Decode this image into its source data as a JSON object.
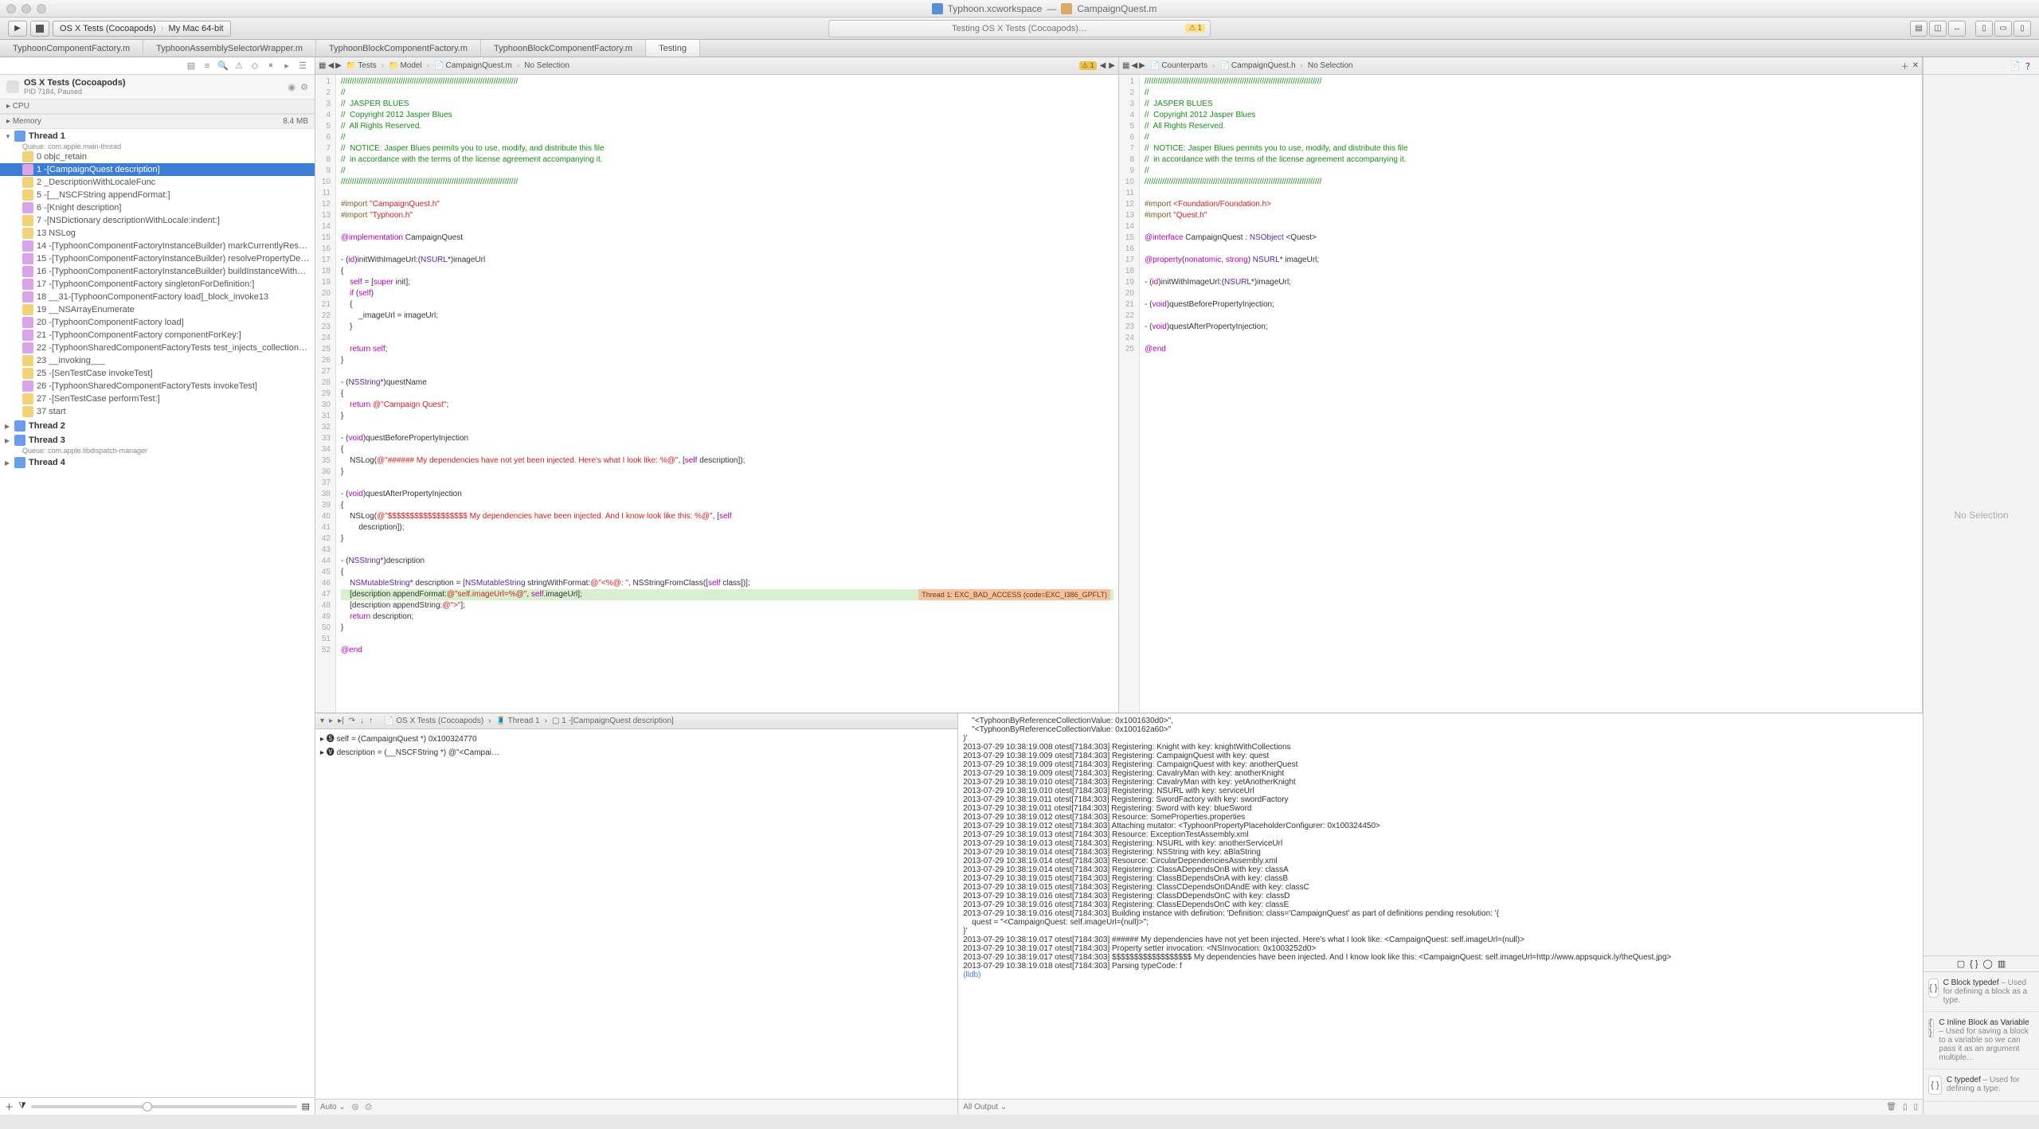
{
  "window": {
    "workspace": "Typhoon.xcworkspace",
    "file": "CampaignQuest.m"
  },
  "toolbar": {
    "scheme": "OS X Tests (Cocoapods)",
    "destination": "My Mac 64-bit",
    "activity": "Testing OS X Tests (Cocoapods)…",
    "warn_count": "1"
  },
  "tabs": [
    "TyphoonComponentFactory.m",
    "TyphoonAssemblySelectorWrapper.m",
    "TyphoonBlockComponentFactory.m",
    "TyphoonBlockComponentFactory.m",
    "Testing"
  ],
  "active_tab": 4,
  "navigator": {
    "title": "OS X Tests (Cocoapods)",
    "subtitle": "PID 7184, Paused",
    "cpu_label": "CPU",
    "memory_label": "Memory",
    "memory_value": "8.4 MB",
    "threads": [
      {
        "name": "Thread 1",
        "queue": "Queue: com.apple.main-thread",
        "expanded": true,
        "frames": [
          {
            "idx": "0",
            "label": "objc_retain",
            "user": false
          },
          {
            "idx": "1",
            "label": "-[CampaignQuest description]",
            "user": true,
            "selected": true
          },
          {
            "idx": "2",
            "label": "_DescriptionWithLocaleFunc",
            "user": false
          },
          {
            "idx": "5",
            "label": "-[__NSCFString appendFormat:]",
            "user": false
          },
          {
            "idx": "6",
            "label": "-[Knight description]",
            "user": true
          },
          {
            "idx": "7",
            "label": "-[NSDictionary descriptionWithLocale:indent:]",
            "user": false
          },
          {
            "idx": "13",
            "label": "NSLog",
            "user": false
          },
          {
            "idx": "14",
            "label": "-[TyphoonComponentFactoryInstanceBuilder) markCurrentlyResolvingDefinition:withInstance:]",
            "user": true
          },
          {
            "idx": "15",
            "label": "-[TyphoonComponentFactoryInstanceBuilder) resolvePropertyDependenciesOn:definition:]",
            "user": true
          },
          {
            "idx": "16",
            "label": "-[TyphoonComponentFactoryInstanceBuilder) buildInstanceWithDefinition:]",
            "user": true
          },
          {
            "idx": "17",
            "label": "-[TyphoonComponentFactory singletonForDefinition:]",
            "user": true
          },
          {
            "idx": "18",
            "label": "__31-[TyphoonComponentFactory load]_block_invoke13",
            "user": true
          },
          {
            "idx": "19",
            "label": "__NSArrayEnumerate",
            "user": false
          },
          {
            "idx": "20",
            "label": "-[TyphoonComponentFactory load]",
            "user": true
          },
          {
            "idx": "21",
            "label": "-[TyphoonComponentFactory componentForKey:]",
            "user": true
          },
          {
            "idx": "22",
            "label": "-[TyphoonSharedComponentFactoryTests test_injects_collection_of_referenced_components_into_set]",
            "user": true
          },
          {
            "idx": "23",
            "label": "__invoking___",
            "user": false
          },
          {
            "idx": "25",
            "label": "-[SenTestCase invokeTest]",
            "user": false
          },
          {
            "idx": "26",
            "label": "-[TyphoonSharedComponentFactoryTests invokeTest]",
            "user": true
          },
          {
            "idx": "27",
            "label": "-[SenTestCase performTest:]",
            "user": false
          },
          {
            "idx": "37",
            "label": "start",
            "user": false
          }
        ]
      },
      {
        "name": "Thread 2"
      },
      {
        "name": "Thread 3",
        "queue": "Queue: com.apple.libdispatch-manager"
      },
      {
        "name": "Thread 4"
      }
    ]
  },
  "editor_left": {
    "path": [
      "Tests",
      "Model",
      "CampaignQuest.m",
      "No Selection"
    ],
    "warn_badge": "1",
    "lines": [
      {
        "n": 1,
        "cls": "c-comment",
        "t": "////////////////////////////////////////////////////////////////////////////////"
      },
      {
        "n": 2,
        "cls": "c-comment",
        "t": "//"
      },
      {
        "n": 3,
        "cls": "c-comment",
        "t": "//  JASPER BLUES"
      },
      {
        "n": 4,
        "cls": "c-comment",
        "t": "//  Copyright 2012 Jasper Blues"
      },
      {
        "n": 5,
        "cls": "c-comment",
        "t": "//  All Rights Reserved."
      },
      {
        "n": 6,
        "cls": "c-comment",
        "t": "//"
      },
      {
        "n": 7,
        "cls": "c-comment",
        "t": "//  NOTICE: Jasper Blues permits you to use, modify, and distribute this file"
      },
      {
        "n": 8,
        "cls": "c-comment",
        "t": "//  in accordance with the terms of the license agreement accompanying it."
      },
      {
        "n": 9,
        "cls": "c-comment",
        "t": "//"
      },
      {
        "n": 10,
        "cls": "c-comment",
        "t": "////////////////////////////////////////////////////////////////////////////////"
      },
      {
        "n": 11,
        "t": ""
      },
      {
        "n": 12,
        "html": "<span class='c-macro'>#import</span> <span class='c-string'>\"CampaignQuest.h\"</span>"
      },
      {
        "n": 13,
        "html": "<span class='c-macro'>#import</span> <span class='c-string'>\"Typhoon.h\"</span>"
      },
      {
        "n": 14,
        "t": ""
      },
      {
        "n": 15,
        "html": "<span class='c-keyword'>@implementation</span> CampaignQuest"
      },
      {
        "n": 16,
        "t": ""
      },
      {
        "n": 17,
        "html": "- (<span class='c-keyword'>id</span>)initWithImageUrl:(<span class='c-type'>NSURL</span>*)imageUrl"
      },
      {
        "n": 18,
        "t": "{"
      },
      {
        "n": 19,
        "html": "    <span class='c-keyword'>self</span> = [<span class='c-keyword'>super</span> init];"
      },
      {
        "n": 20,
        "html": "    <span class='c-keyword'>if</span> (<span class='c-keyword'>self</span>)"
      },
      {
        "n": 21,
        "t": "    {"
      },
      {
        "n": 22,
        "html": "        _imageUrl = imageUrl;"
      },
      {
        "n": 23,
        "t": "    }"
      },
      {
        "n": 24,
        "t": ""
      },
      {
        "n": 25,
        "html": "    <span class='c-keyword'>return</span> <span class='c-keyword'>self</span>;"
      },
      {
        "n": 26,
        "t": "}"
      },
      {
        "n": 27,
        "t": ""
      },
      {
        "n": 28,
        "html": "- (<span class='c-type'>NSString</span>*)questName"
      },
      {
        "n": 29,
        "t": "{"
      },
      {
        "n": 30,
        "html": "    <span class='c-keyword'>return</span> <span class='c-string'>@\"Campaign Quest\"</span>;"
      },
      {
        "n": 31,
        "t": "}"
      },
      {
        "n": 32,
        "t": ""
      },
      {
        "n": 33,
        "html": "- (<span class='c-keyword'>void</span>)questBeforePropertyInjection"
      },
      {
        "n": 34,
        "t": "{"
      },
      {
        "n": 35,
        "html": "    NSLog(<span class='c-string'>@\"###### My dependencies have not yet been injected. Here's what I look like: %@\"</span>, [<span class='c-keyword'>self</span> description]);"
      },
      {
        "n": 36,
        "t": "}"
      },
      {
        "n": 37,
        "t": ""
      },
      {
        "n": 38,
        "html": "- (<span class='c-keyword'>void</span>)questAfterPropertyInjection"
      },
      {
        "n": 39,
        "t": "{"
      },
      {
        "n": 40,
        "html": "    NSLog(<span class='c-string'>@\"$$$$$$$$$$$$$$$$$$ My dependencies have been injected. And I know look like this: %@\"</span>, [<span class='c-keyword'>self</span>"
      },
      {
        "n": 41,
        "html": "        description]);"
      },
      {
        "n": 42,
        "t": "}"
      },
      {
        "n": 43,
        "t": ""
      },
      {
        "n": 44,
        "html": "- (<span class='c-type'>NSString</span>*)description"
      },
      {
        "n": 45,
        "t": "{"
      },
      {
        "n": 46,
        "html": "    <span class='c-type'>NSMutableString</span>* description = [<span class='c-type'>NSMutableString</span> stringWithFormat:<span class='c-string'>@\"&lt;%@: \"</span>, NSStringFromClass([<span class='c-keyword'>self</span> class])];"
      },
      {
        "n": 47,
        "hl": true,
        "html": "    [description appendFormat:<span class='c-string'>@\"self.imageUrl=%@\"</span>, <span class='c-keyword'>self</span>.imageUrl];",
        "err": "Thread 1: EXC_BAD_ACCESS (code=EXC_I386_GPFLT)"
      },
      {
        "n": 48,
        "html": "    [description appendString:<span class='c-string'>@\"&gt;\"</span>];"
      },
      {
        "n": 49,
        "html": "    <span class='c-keyword'>return</span> description;"
      },
      {
        "n": 50,
        "t": "}"
      },
      {
        "n": 51,
        "t": ""
      },
      {
        "n": 52,
        "html": "<span class='c-keyword'>@end</span>"
      }
    ]
  },
  "editor_right": {
    "path": [
      "Counterparts",
      "CampaignQuest.h",
      "No Selection"
    ],
    "lines": [
      {
        "n": 1,
        "cls": "c-comment",
        "t": "////////////////////////////////////////////////////////////////////////////////"
      },
      {
        "n": 2,
        "cls": "c-comment",
        "t": "//"
      },
      {
        "n": 3,
        "cls": "c-comment",
        "t": "//  JASPER BLUES"
      },
      {
        "n": 4,
        "cls": "c-comment",
        "t": "//  Copyright 2012 Jasper Blues"
      },
      {
        "n": 5,
        "cls": "c-comment",
        "t": "//  All Rights Reserved."
      },
      {
        "n": 6,
        "cls": "c-comment",
        "t": "//"
      },
      {
        "n": 7,
        "cls": "c-comment",
        "t": "//  NOTICE: Jasper Blues permits you to use, modify, and distribute this file"
      },
      {
        "n": 8,
        "cls": "c-comment",
        "t": "//  in accordance with the terms of the license agreement accompanying it."
      },
      {
        "n": 9,
        "cls": "c-comment",
        "t": "//"
      },
      {
        "n": 10,
        "cls": "c-comment",
        "t": "////////////////////////////////////////////////////////////////////////////////"
      },
      {
        "n": 11,
        "t": ""
      },
      {
        "n": 12,
        "html": "<span class='c-macro'>#import</span> <span class='c-string'>&lt;Foundation/Foundation.h&gt;</span>"
      },
      {
        "n": 13,
        "html": "<span class='c-macro'>#import</span> <span class='c-string'>\"Quest.h\"</span>"
      },
      {
        "n": 14,
        "t": ""
      },
      {
        "n": 15,
        "html": "<span class='c-keyword'>@interface</span> CampaignQuest : <span class='c-type'>NSObject</span> &lt;Quest&gt;"
      },
      {
        "n": 16,
        "t": ""
      },
      {
        "n": 17,
        "html": "<span class='c-keyword'>@property</span>(<span class='c-keyword'>nonatomic</span>, <span class='c-keyword'>strong</span>) <span class='c-type'>NSURL</span>* imageUrl;"
      },
      {
        "n": 18,
        "t": ""
      },
      {
        "n": 19,
        "html": "- (<span class='c-keyword'>id</span>)initWithImageUrl:(<span class='c-type'>NSURL</span>*)imageUrl;"
      },
      {
        "n": 20,
        "t": ""
      },
      {
        "n": 21,
        "html": "- (<span class='c-keyword'>void</span>)questBeforePropertyInjection;"
      },
      {
        "n": 22,
        "t": ""
      },
      {
        "n": 23,
        "html": "- (<span class='c-keyword'>void</span>)questAfterPropertyInjection;"
      },
      {
        "n": 24,
        "t": ""
      },
      {
        "n": 25,
        "html": "<span class='c-keyword'>@end</span>"
      }
    ]
  },
  "debug_bar": {
    "process": "OS X Tests (Cocoapods)",
    "thread": "Thread 1",
    "frame": "1 -[CampaignQuest description]"
  },
  "variables": [
    "▸ 🅢 self = (CampaignQuest *) 0x100324770",
    "▸ 🅥 description = (__NSCFString *) @\"<Campai…"
  ],
  "console": [
    "    \"<TyphoonByReferenceCollectionValue: 0x1001630d0>\",",
    "    \"<TyphoonByReferenceCollectionValue: 0x100162a60>\"",
    ")'",
    "2013-07-29 10:38:19.008 otest[7184:303] Registering: Knight with key: knightWithCollections",
    "2013-07-29 10:38:19.009 otest[7184:303] Registering: CampaignQuest with key: quest",
    "2013-07-29 10:38:19.009 otest[7184:303] Registering: CampaignQuest with key: anotherQuest",
    "2013-07-29 10:38:19.009 otest[7184:303] Registering: CavalryMan with key: anotherKnight",
    "2013-07-29 10:38:19.010 otest[7184:303] Registering: CavalryMan with key: yetAnotherKnight",
    "2013-07-29 10:38:19.010 otest[7184:303] Registering: NSURL with key: serviceUrl",
    "2013-07-29 10:38:19.011 otest[7184:303] Registering: SwordFactory with key: swordFactory",
    "2013-07-29 10:38:19.011 otest[7184:303] Registering: Sword with key: blueSword",
    "2013-07-29 10:38:19.012 otest[7184:303] Resource: SomeProperties.properties",
    "2013-07-29 10:38:19.012 otest[7184:303] Attaching mutator: <TyphoonPropertyPlaceholderConfigurer: 0x100324450>",
    "2013-07-29 10:38:19.013 otest[7184:303] Resource: ExceptionTestAssembly.xml",
    "2013-07-29 10:38:19.013 otest[7184:303] Registering: NSURL with key: anotherServiceUrl",
    "2013-07-29 10:38:19.014 otest[7184:303] Registering: NSString with key: aBlaString",
    "2013-07-29 10:38:19.014 otest[7184:303] Resource: CircularDependenciesAssembly.xml",
    "2013-07-29 10:38:19.014 otest[7184:303] Registering: ClassADependsOnB with key: classA",
    "2013-07-29 10:38:19.015 otest[7184:303] Registering: ClassBDependsOnA with key: classB",
    "2013-07-29 10:38:19.015 otest[7184:303] Registering: ClassCDependsOnDAndE with key: classC",
    "2013-07-29 10:38:19.016 otest[7184:303] Registering: ClassDDependsOnC with key: classD",
    "2013-07-29 10:38:19.016 otest[7184:303] Registering: ClassEDependsOnC with key: classE",
    "2013-07-29 10:38:19.016 otest[7184:303] Building instance with definition: 'Definition: class='CampaignQuest' as part of definitions pending resolution: '{",
    "    quest = \"<CampaignQuest: self.imageUrl=(null)>\";",
    "}'",
    "2013-07-29 10:38:19.017 otest[7184:303] ###### My dependencies have not yet been injected. Here's what I look like: <CampaignQuest: self.imageUrl=(null)>",
    "2013-07-29 10:38:19.017 otest[7184:303] Property setter invocation: <NSInvocation: 0x1003252d0>",
    "2013-07-29 10:38:19.017 otest[7184:303] $$$$$$$$$$$$$$$$$$ My dependencies have been injected. And I know look like this: <CampaignQuest: self.imageUrl=http://www.appsquick.ly/theQuest.jpg>",
    "2013-07-29 10:38:19.018 otest[7184:303] Parsing typeCode: f",
    "(lldb) "
  ],
  "debug_footer_left": "Auto ⌄",
  "debug_footer_right": "All Output ⌄",
  "inspector": {
    "empty": "No Selection",
    "snippets": [
      {
        "title": "C Block typedef",
        "desc": " – Used for defining a block as a type."
      },
      {
        "title": "C Inline Block as Variable",
        "desc": " – Used for saving a block to a variable so we can pass it as an argument multiple…"
      },
      {
        "title": "C typedef",
        "desc": " – Used for defining a type."
      }
    ]
  }
}
